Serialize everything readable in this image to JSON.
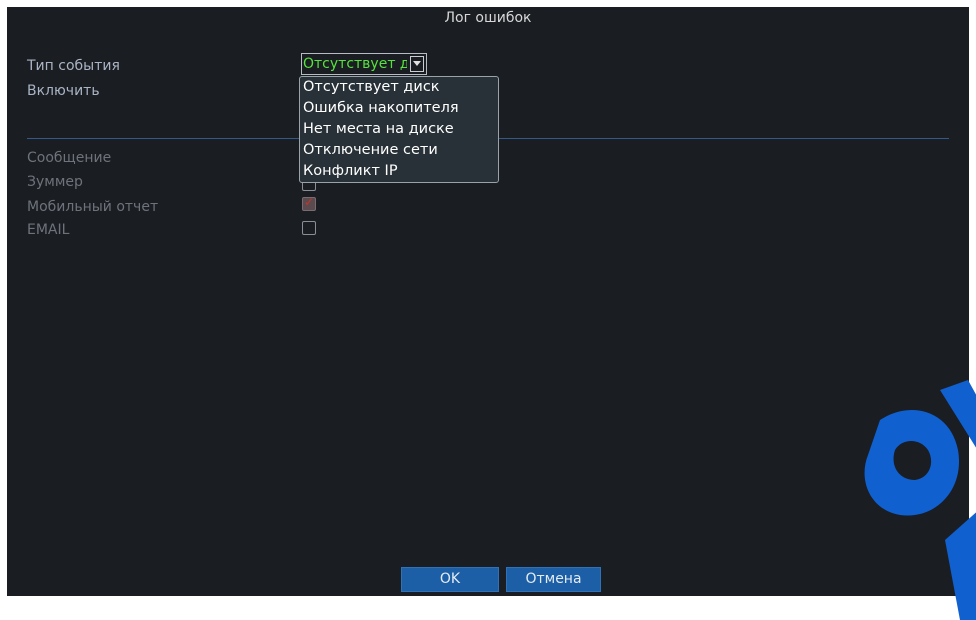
{
  "window": {
    "title": "Лог ошибок"
  },
  "form": {
    "event_type_label": "Тип события",
    "enable_label": "Включить",
    "event_type_value": "Отсутствует диск",
    "message_label": "Сообщение",
    "buzzer_label": "Зуммер",
    "mobile_report_label": "Мобильный отчет",
    "email_label": "EMAIL"
  },
  "checkboxes": {
    "buzzer": false,
    "mobile_report": true,
    "email": false
  },
  "dropdown": {
    "options": [
      "Отсутствует диск",
      "Ошибка накопителя",
      "Нет места на диске",
      "Отключение сети",
      "Конфликт IP"
    ]
  },
  "buttons": {
    "ok": "OK",
    "cancel": "Отмена"
  },
  "colors": {
    "background": "#1a1d22",
    "accent_blue": "#1d5fa6",
    "selected_text_green": "#55e33c",
    "watermark": "#1060cf"
  }
}
